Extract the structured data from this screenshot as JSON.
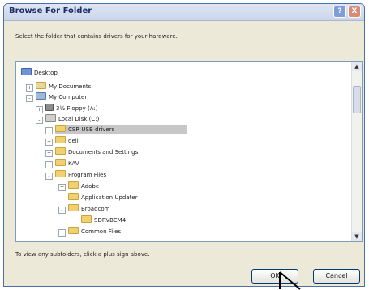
{
  "window": {
    "title": "Browse For Folder",
    "help_label": "?",
    "close_label": "X"
  },
  "instruction": "Select the folder that contains drivers for your hardware.",
  "tree": {
    "items": [
      {
        "label": "Desktop",
        "icon": "desktop-icon",
        "expander": ""
      },
      {
        "label": "My Documents",
        "icon": "folder-icon",
        "expander": "+"
      },
      {
        "label": "My Computer",
        "icon": "computer-icon",
        "expander": "-"
      },
      {
        "label": "3½ Floppy (A:)",
        "icon": "floppy-icon",
        "expander": "+"
      },
      {
        "label": "Local Disk (C:)",
        "icon": "drive-icon",
        "expander": "-"
      },
      {
        "label": "CSR USB drivers",
        "icon": "folder-icon",
        "expander": "+"
      },
      {
        "label": "dell",
        "icon": "folder-icon",
        "expander": "+"
      },
      {
        "label": "Documents and Settings",
        "icon": "folder-icon",
        "expander": "+"
      },
      {
        "label": "KAV",
        "icon": "folder-icon",
        "expander": "+"
      },
      {
        "label": "Program Files",
        "icon": "folder-icon",
        "expander": "-"
      },
      {
        "label": "Adobe",
        "icon": "folder-icon",
        "expander": "+"
      },
      {
        "label": "Application Updater",
        "icon": "folder-icon",
        "expander": ""
      },
      {
        "label": "Broadcom",
        "icon": "folder-icon",
        "expander": "-"
      },
      {
        "label": "SDRVBCM4",
        "icon": "folder-icon",
        "expander": ""
      },
      {
        "label": "Common Files",
        "icon": "folder-icon",
        "expander": "+"
      }
    ],
    "selected_index": 5,
    "scroll_up": "▲",
    "scroll_down": "▼"
  },
  "hint": "To view any subfolders, click a plus sign above.",
  "buttons": {
    "ok_label": "OK",
    "cancel_label": "Cancel"
  }
}
